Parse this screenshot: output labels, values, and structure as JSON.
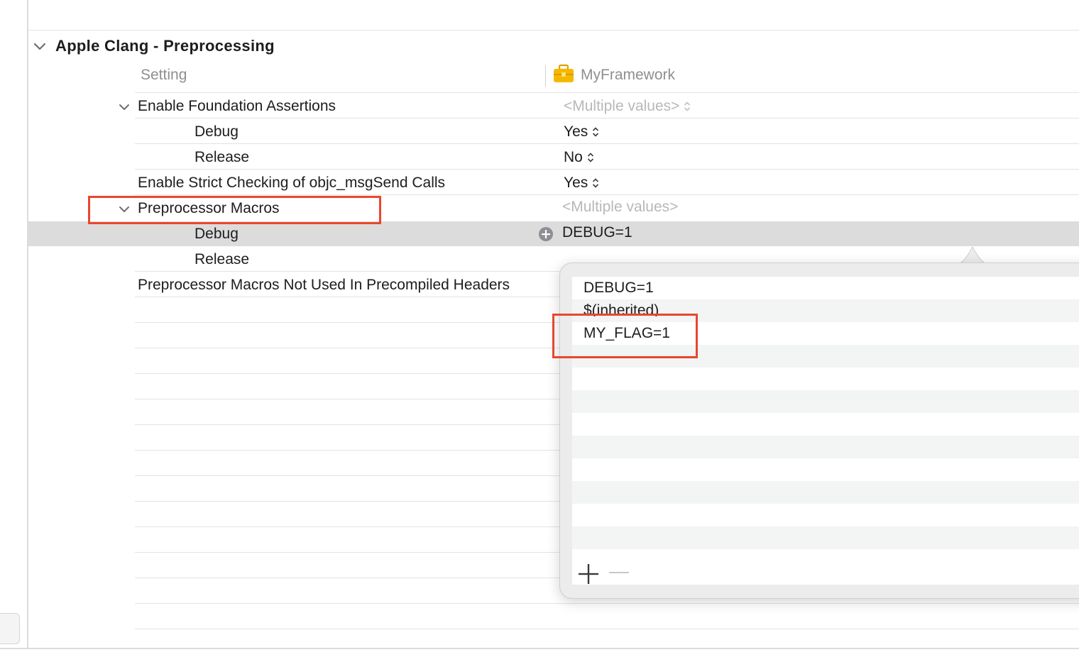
{
  "section": {
    "title": "Apple Clang - Preprocessing"
  },
  "header": {
    "setting_label": "Setting",
    "target_label": "MyFramework"
  },
  "rows": [
    {
      "label": "Enable Foundation Assertions",
      "value": "<Multiple values>"
    },
    {
      "label": "Debug",
      "value": "Yes"
    },
    {
      "label": "Release",
      "value": "No"
    },
    {
      "label": "Enable Strict Checking of objc_msgSend Calls",
      "value": "Yes"
    },
    {
      "label": "Preprocessor Macros",
      "value": "<Multiple values>"
    },
    {
      "label": "Debug",
      "value": "DEBUG=1"
    },
    {
      "label": "Release",
      "value": ""
    },
    {
      "label": "Preprocessor Macros Not Used In Precompiled Headers",
      "value": ""
    }
  ],
  "popover": {
    "items": [
      "DEBUG=1",
      "$(inherited)",
      "MY_FLAG=1"
    ],
    "add_label": "+",
    "remove_label": "−"
  },
  "colors": {
    "highlight_box": "#e8472b",
    "target_icon": "#f5b800",
    "selected_row": "#dcdcdc"
  }
}
